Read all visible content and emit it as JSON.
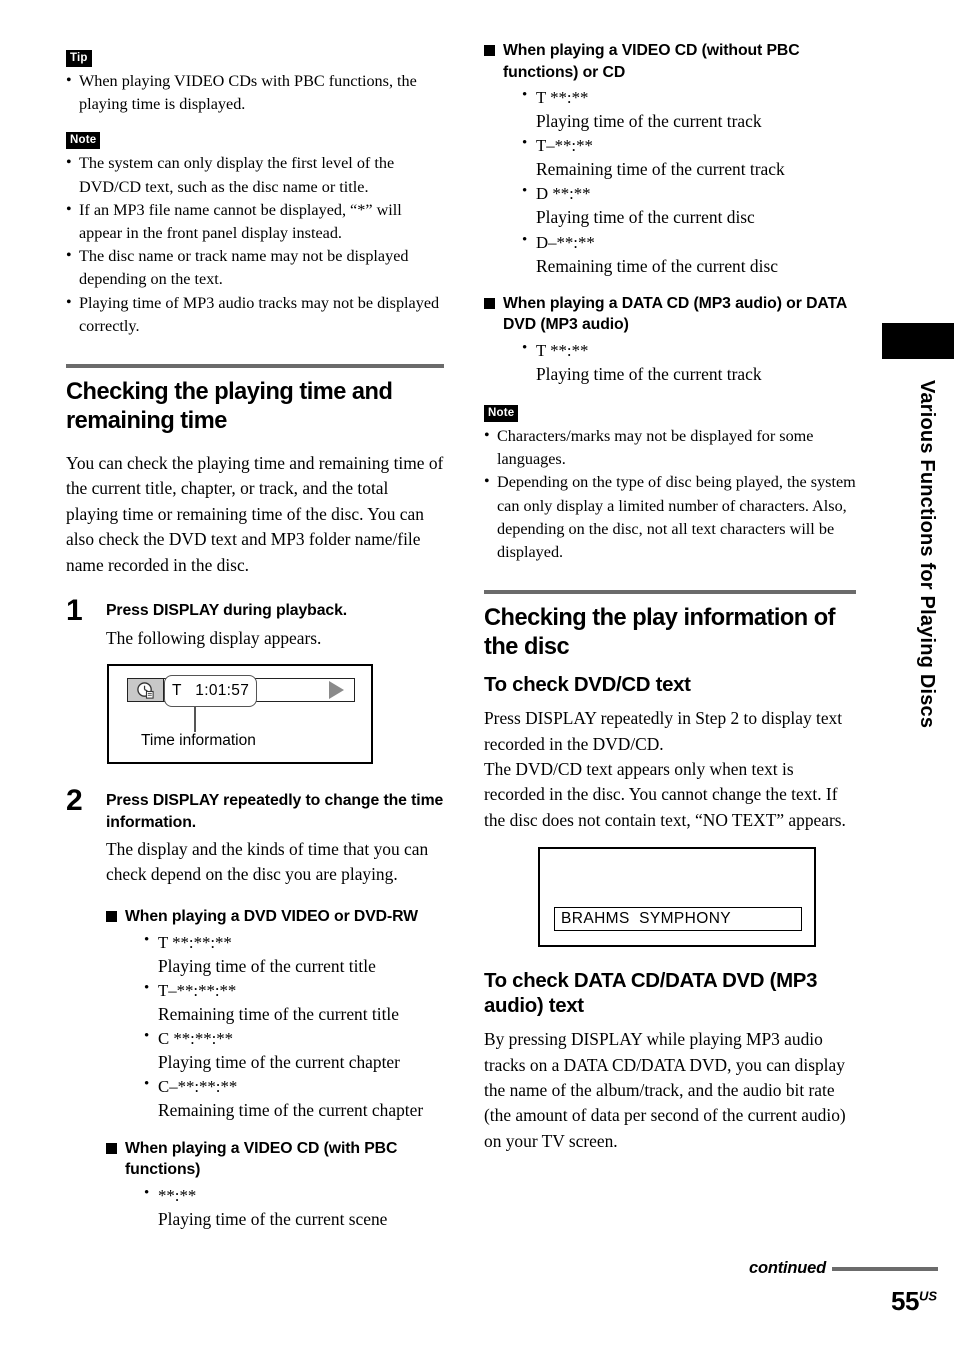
{
  "sidebar": {
    "chapter_label": "Various Functions for Playing Discs"
  },
  "footer": {
    "continued": "continued",
    "page_number": "55",
    "page_suffix": "US"
  },
  "left_column": {
    "tip": {
      "tag": "Tip",
      "items": [
        "When playing VIDEO CDs with PBC functions, the playing time is displayed."
      ]
    },
    "note": {
      "tag": "Note",
      "items": [
        "The system can only display the first level of the DVD/CD text, such as the disc name or title.",
        "If an MP3 file name cannot be displayed, “*” will appear in the front panel display instead.",
        "The disc name or track name may not be displayed depending on the text.",
        "Playing time of MP3 audio tracks may not be displayed correctly."
      ]
    },
    "section": {
      "heading": "Checking the playing time and remaining time",
      "intro": "You can check the playing time and remaining time of the current title, chapter, or track, and the total playing time or remaining time of the disc. You can also check the DVD text and MP3 folder name/file name recorded in the disc."
    },
    "step1": {
      "number": "1",
      "title": "Press DISPLAY during playback.",
      "body": "The following display appears.",
      "display": {
        "icon": "clock-icon",
        "time_value": "T   1:01:57",
        "callout_label": "Time information",
        "play_icon": "play-triangle-icon"
      }
    },
    "step2": {
      "number": "2",
      "title": "Press DISPLAY repeatedly to change the time information.",
      "body": "The display and the kinds of time that you can check depend on the disc you are playing."
    },
    "groups": [
      {
        "heading": "When playing a DVD VIDEO or DVD-RW",
        "entries": [
          {
            "code": "T **:**:**",
            "desc": "Playing time of the current title"
          },
          {
            "code": "T–**:**:**",
            "desc": "Remaining time of the current title"
          },
          {
            "code": "C **:**:**",
            "desc": "Playing time of the current chapter"
          },
          {
            "code": "C–**:**:**",
            "desc": "Remaining time of the current chapter"
          }
        ]
      },
      {
        "heading": "When playing a VIDEO CD (with PBC functions)",
        "entries": [
          {
            "code": "**:**",
            "desc": "Playing time of the current scene"
          }
        ]
      }
    ]
  },
  "right_column": {
    "groups": [
      {
        "heading": "When playing a VIDEO CD (without PBC functions) or CD",
        "entries": [
          {
            "code": "T **:**",
            "desc": "Playing time of the current track"
          },
          {
            "code": "T–**:**",
            "desc": "Remaining time of the current track"
          },
          {
            "code": "D **:**",
            "desc": "Playing time of the current disc"
          },
          {
            "code": "D–**:**",
            "desc": "Remaining time of the current disc"
          }
        ]
      },
      {
        "heading": "When playing a DATA CD (MP3 audio) or DATA DVD (MP3 audio)",
        "entries": [
          {
            "code": "T **:**",
            "desc": "Playing time of the current track"
          }
        ]
      }
    ],
    "note": {
      "tag": "Note",
      "items": [
        "Characters/marks may not be displayed for some languages.",
        "Depending on the type of disc being played, the system can only display a limited number of characters. Also, depending on the disc, not all text characters will be displayed."
      ]
    },
    "section": {
      "heading": "Checking the play information of the disc"
    },
    "dvdcd_text": {
      "sub_heading": "To check DVD/CD text",
      "paragraph1": "Press DISPLAY repeatedly in Step 2 to display text recorded in the DVD/CD.",
      "paragraph2": "The DVD/CD text appears only when text is recorded in the disc. You cannot change the text. If the disc does not contain text, “NO TEXT” appears.",
      "display": {
        "field_value": "BRAHMS  SYMPHONY"
      }
    },
    "datacd_text": {
      "sub_heading": "To check DATA CD/DATA DVD (MP3 audio) text",
      "paragraph": "By pressing DISPLAY while playing MP3 audio tracks on a DATA CD/DATA DVD, you can display the name of the album/track, and the audio bit rate (the amount of data per second of the current audio) on your TV screen."
    }
  }
}
